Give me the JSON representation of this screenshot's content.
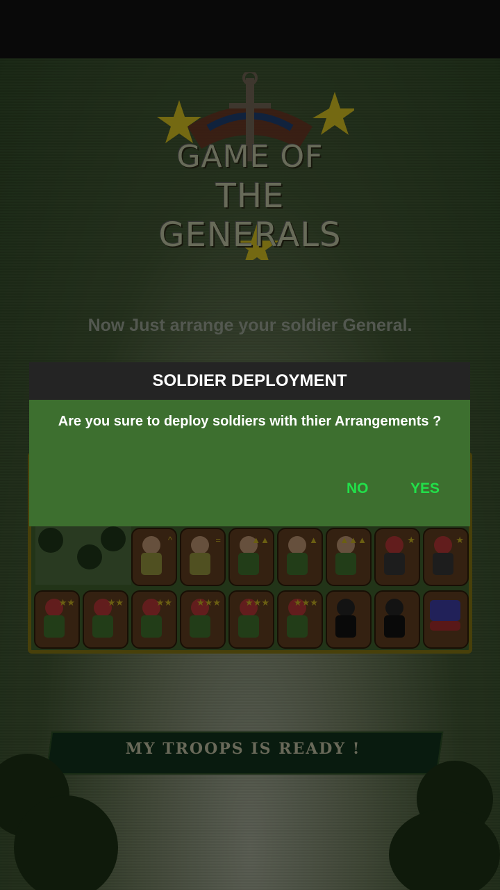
{
  "logo": {
    "line1": "GAME OF",
    "line2": "THE GENERALS"
  },
  "subtitle": "Now Just arrange your soldier General.",
  "banner": {
    "label": "MY TROOPS IS READY !"
  },
  "dialog": {
    "title": "SOLDIER DEPLOYMENT",
    "message": "Are you sure to deploy soldiers with thier Arrangements ?",
    "no_label": "NO",
    "yes_label": "YES"
  },
  "colors": {
    "dialog_bg": "#3d6f2f",
    "dialog_header": "#242424",
    "button_text": "#22e04a"
  }
}
